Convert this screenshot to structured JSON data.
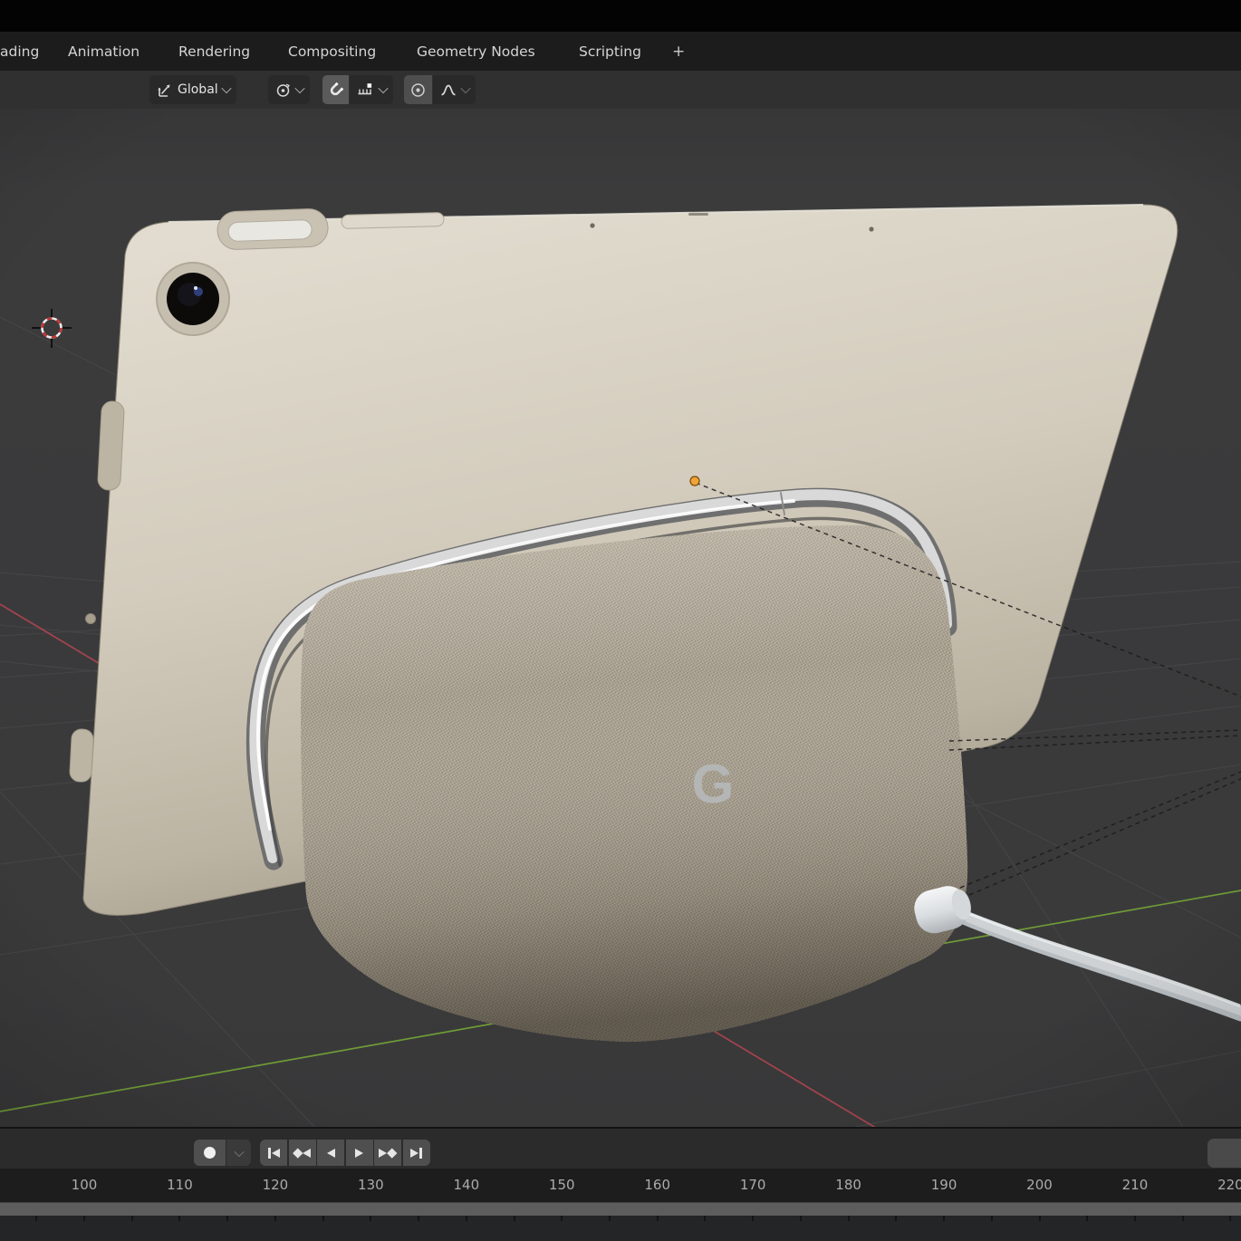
{
  "workspace_tabs": {
    "items": [
      {
        "label": "ading"
      },
      {
        "label": "Animation"
      },
      {
        "label": "Rendering"
      },
      {
        "label": "Compositing"
      },
      {
        "label": "Geometry Nodes"
      },
      {
        "label": "Scripting"
      }
    ],
    "add_tab_label": "+"
  },
  "viewport_header": {
    "transform_orientation": {
      "label": "Global",
      "icon": "orientation-axes-icon"
    },
    "pivot_point": {
      "icon": "pivot-point-icon"
    },
    "snapping": {
      "icon": "magnet-icon",
      "target_icon": "snap-increment-icon"
    },
    "proportional_editing": {
      "icon": "proportional-circle-icon",
      "falloff_icon": "falloff-curve-icon"
    }
  },
  "scene": {
    "dock_logo": "G",
    "axis_x_color": "#b1454f",
    "axis_y_color": "#72a136",
    "origin_dot_color": "#efa33b",
    "grid_color": "#47484a",
    "tablet_color": "#d3ccbd",
    "dock_fabric_color": "#a89f90",
    "cable_color": "#c8cccf"
  },
  "timeline": {
    "playback_buttons": [
      {
        "name": "jump-to-start"
      },
      {
        "name": "jump-to-prev-keyframe"
      },
      {
        "name": "play-reverse"
      },
      {
        "name": "play"
      },
      {
        "name": "jump-to-next-keyframe"
      },
      {
        "name": "jump-to-end"
      }
    ],
    "frame_labels": [
      "100",
      "110",
      "120",
      "130",
      "140",
      "150",
      "160",
      "170",
      "180",
      "190",
      "200",
      "210",
      "220"
    ]
  }
}
